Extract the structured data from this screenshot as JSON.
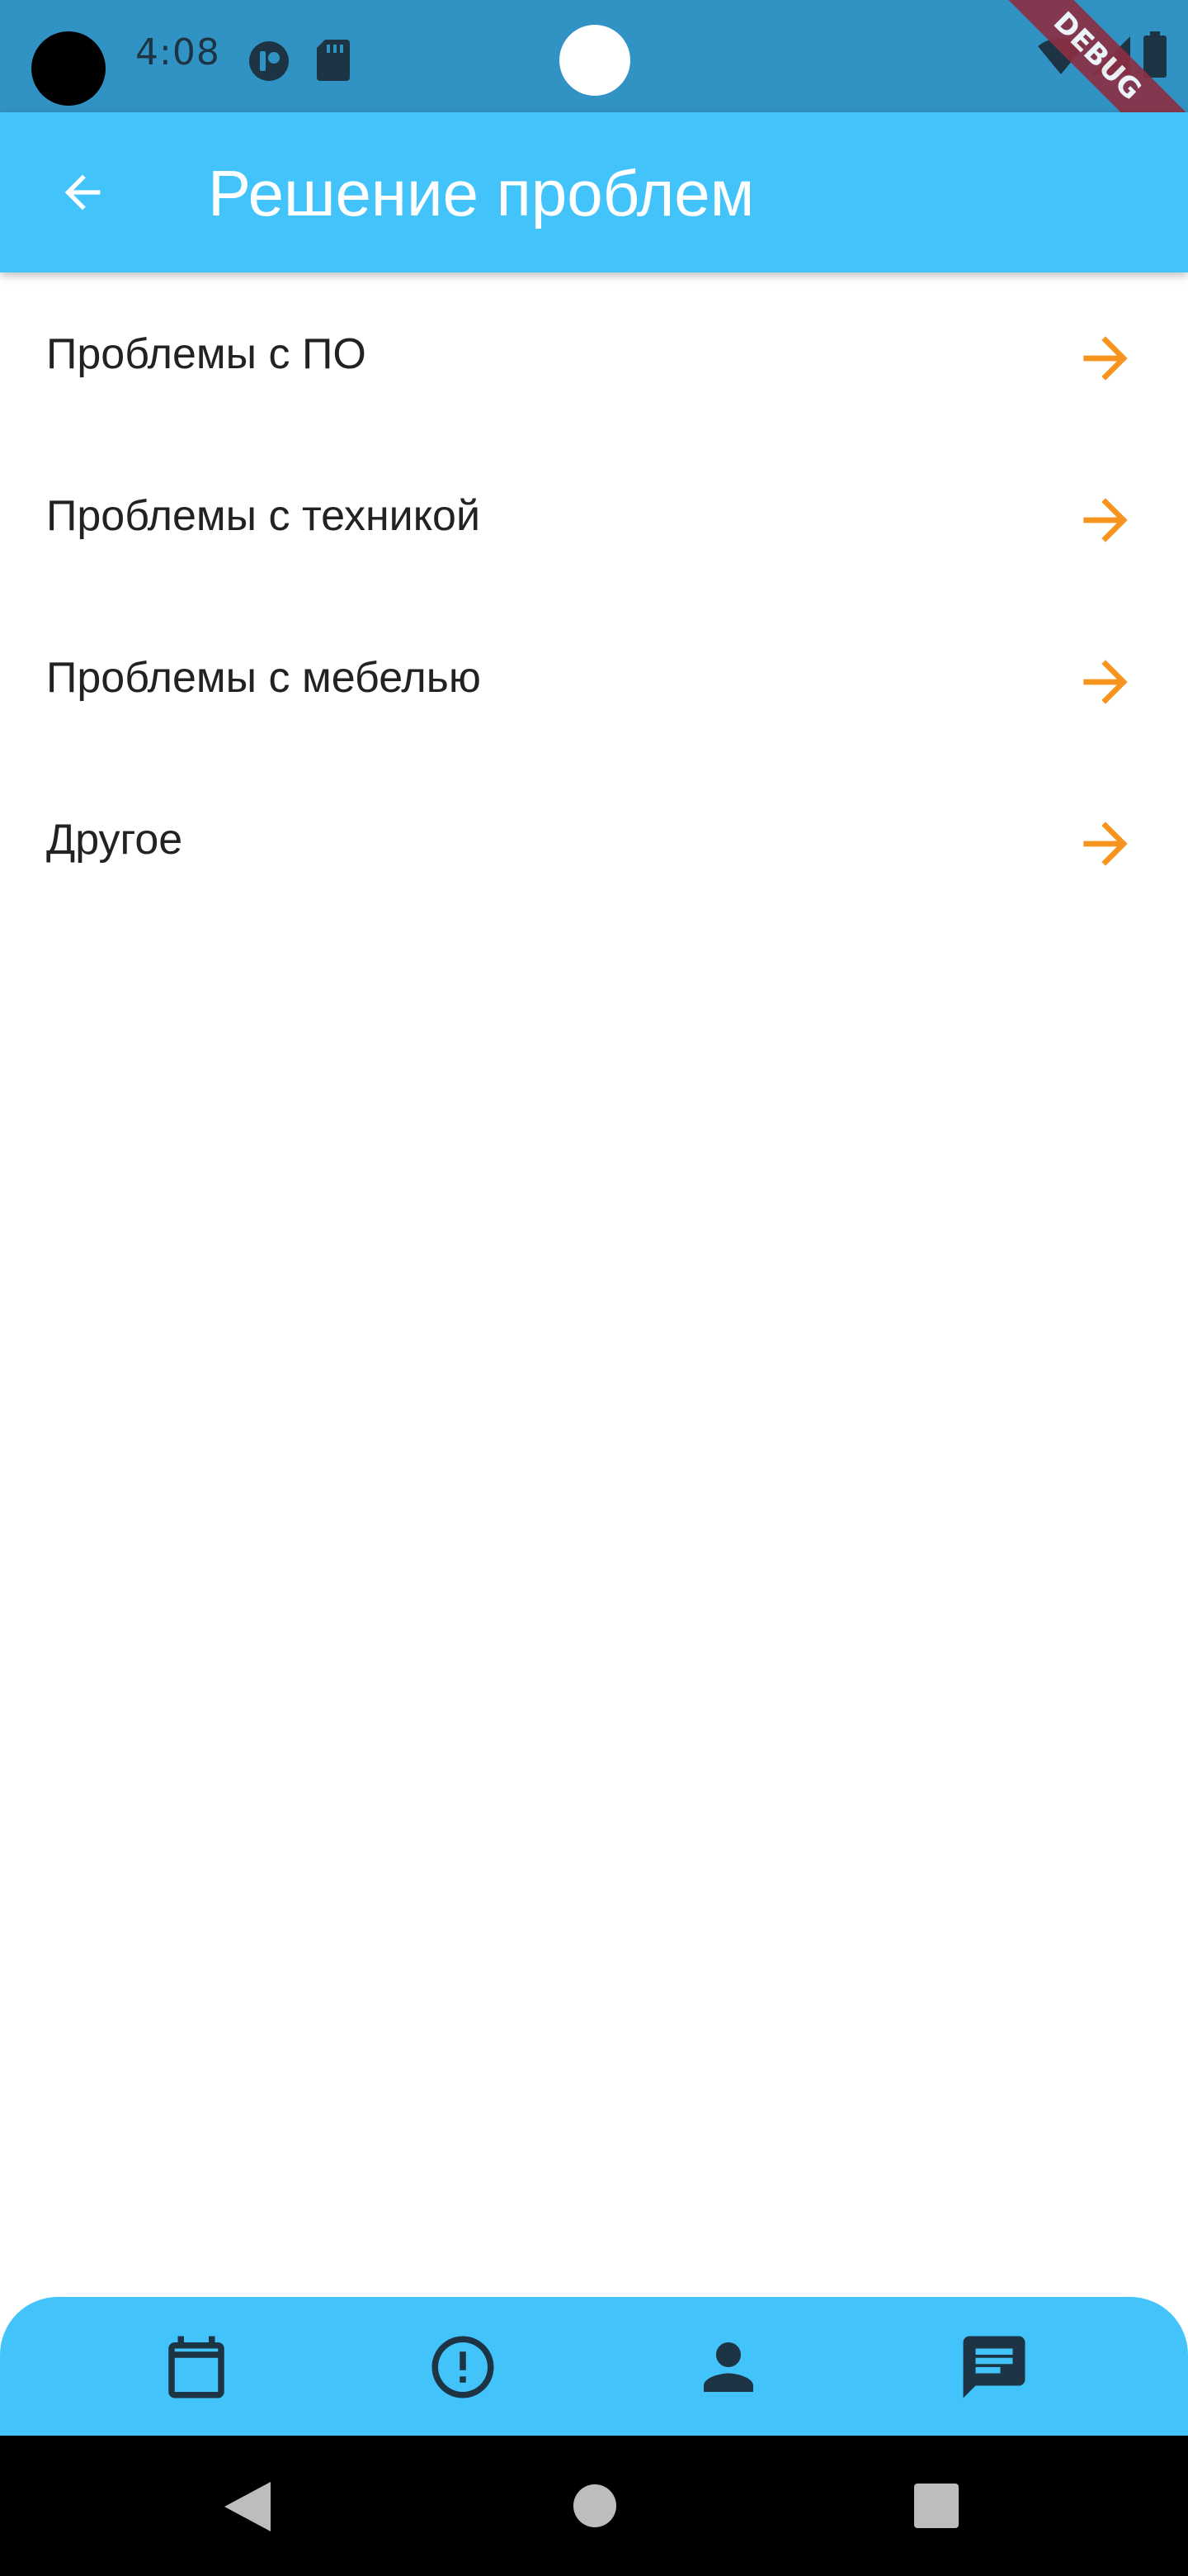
{
  "status_bar": {
    "time": "4:08",
    "debug_label": "DEBUG"
  },
  "app_bar": {
    "back_icon": "arrow-back-icon",
    "title": "Решение проблем"
  },
  "problems": [
    {
      "label": "Проблемы с ПО",
      "icon": "arrow-forward-icon"
    },
    {
      "label": "Проблемы с техникой",
      "icon": "arrow-forward-icon"
    },
    {
      "label": "Проблемы с мебелью",
      "icon": "arrow-forward-icon"
    },
    {
      "label": "Другое",
      "icon": "arrow-forward-icon"
    }
  ],
  "bottom_nav": {
    "items": [
      {
        "icon": "calendar-icon"
      },
      {
        "icon": "alert-circle-icon"
      },
      {
        "icon": "person-icon"
      },
      {
        "icon": "chat-icon",
        "selected": true
      }
    ]
  },
  "colors": {
    "status_bar": "#3193c4",
    "app_bar": "#42c3fa",
    "arrow": "#f7941d",
    "nav_icon": "#1d3444"
  }
}
